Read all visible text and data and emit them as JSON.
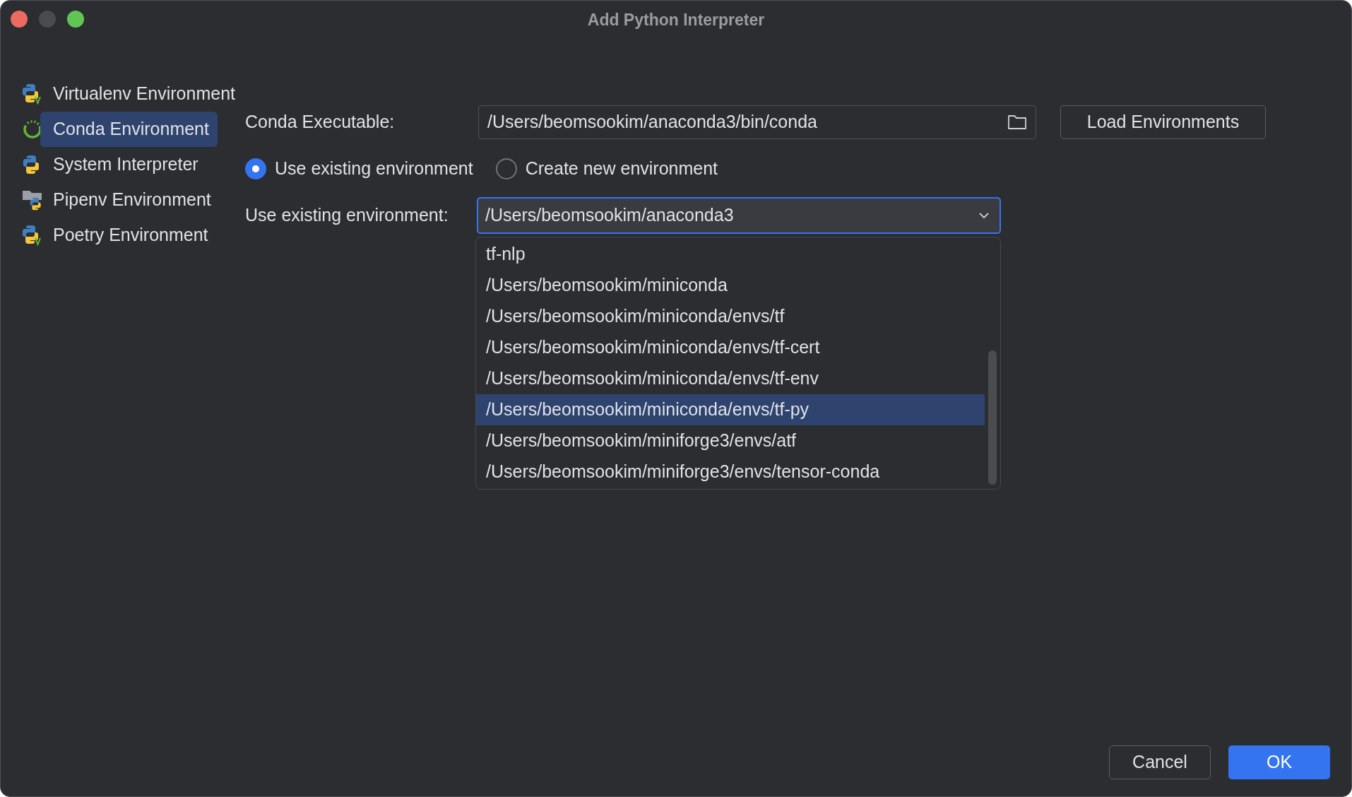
{
  "window": {
    "title": "Add Python Interpreter"
  },
  "sidebar": {
    "items": [
      {
        "label": "Virtualenv Environment",
        "kind": "virtualenv",
        "selected": false
      },
      {
        "label": "Conda Environment",
        "kind": "conda",
        "selected": true
      },
      {
        "label": "System Interpreter",
        "kind": "python",
        "selected": false
      },
      {
        "label": "Pipenv Environment",
        "kind": "pipenv",
        "selected": false
      },
      {
        "label": "Poetry Environment",
        "kind": "virtualenv",
        "selected": false
      }
    ]
  },
  "conda_executable": {
    "label": "Conda Executable:",
    "value": "/Users/beomsookim/anaconda3/bin/conda"
  },
  "load_button": "Load Environments",
  "mode_options": [
    {
      "label": "Use existing environment",
      "selected": true
    },
    {
      "label": "Create new environment",
      "selected": false
    }
  ],
  "environment": {
    "label": "Use existing environment:",
    "value": "/Users/beomsookim/anaconda3",
    "options": [
      {
        "label": "tf-nlp",
        "selected": false
      },
      {
        "label": "/Users/beomsookim/miniconda",
        "selected": false
      },
      {
        "label": "/Users/beomsookim/miniconda/envs/tf",
        "selected": false
      },
      {
        "label": "/Users/beomsookim/miniconda/envs/tf-cert",
        "selected": false
      },
      {
        "label": "/Users/beomsookim/miniconda/envs/tf-env",
        "selected": false
      },
      {
        "label": "/Users/beomsookim/miniconda/envs/tf-py",
        "selected": true
      },
      {
        "label": "/Users/beomsookim/miniforge3/envs/atf",
        "selected": false
      },
      {
        "label": "/Users/beomsookim/miniforge3/envs/tensor-conda",
        "selected": false
      }
    ]
  },
  "buttons": [
    {
      "label": "Cancel",
      "kind": "secondary"
    },
    {
      "label": "OK",
      "kind": "primary"
    }
  ]
}
